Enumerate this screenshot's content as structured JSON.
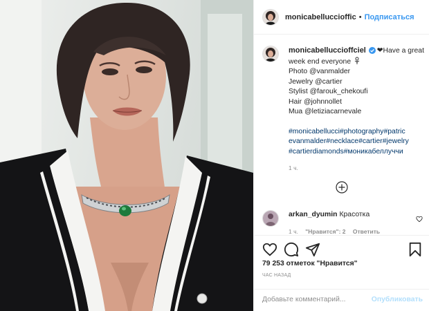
{
  "header": {
    "username": "monicabelluccioffic",
    "separator": "•",
    "follow_label": "Подписаться"
  },
  "caption": {
    "username": "monicabelluccioffciel",
    "text_line1": "Have a great week end everyone",
    "credit_lines": [
      "Photo @vanmalder",
      "Jewelry @cartier",
      "Stylist @farouk_chekoufi",
      "Hair @johnnollet",
      "Mua @letiziacarnevale"
    ],
    "hashtag_lines": [
      "#monicabellucci#photography#patric",
      "evanmalder#necklace#cartier#jewelry",
      "#cartierdiamonds#моникабеллуччи"
    ],
    "time": "1 ч."
  },
  "comment": {
    "username": "arkan_dyumin",
    "text": "Красотка",
    "time": "1 ч.",
    "likes": "\"Нравится\": 2",
    "reply": "Ответить"
  },
  "likes_text": "79 253 отметок \"Нравится\"",
  "posted_ago": "ЧАС НАЗАД",
  "add_comment": {
    "placeholder": "Добавьте комментарий...",
    "post_label": "Опубликовать"
  },
  "colors": {
    "link_blue": "#3897f0",
    "hashtag_blue": "#00376b",
    "muted_gray": "#8e8e8e",
    "disabled_blue": "#b2dffc"
  },
  "icons": {
    "actions": [
      "heart-icon",
      "comment-icon",
      "share-icon",
      "save-icon"
    ],
    "load_more": "plus-circle-icon",
    "verified": "verified-badge-icon"
  }
}
